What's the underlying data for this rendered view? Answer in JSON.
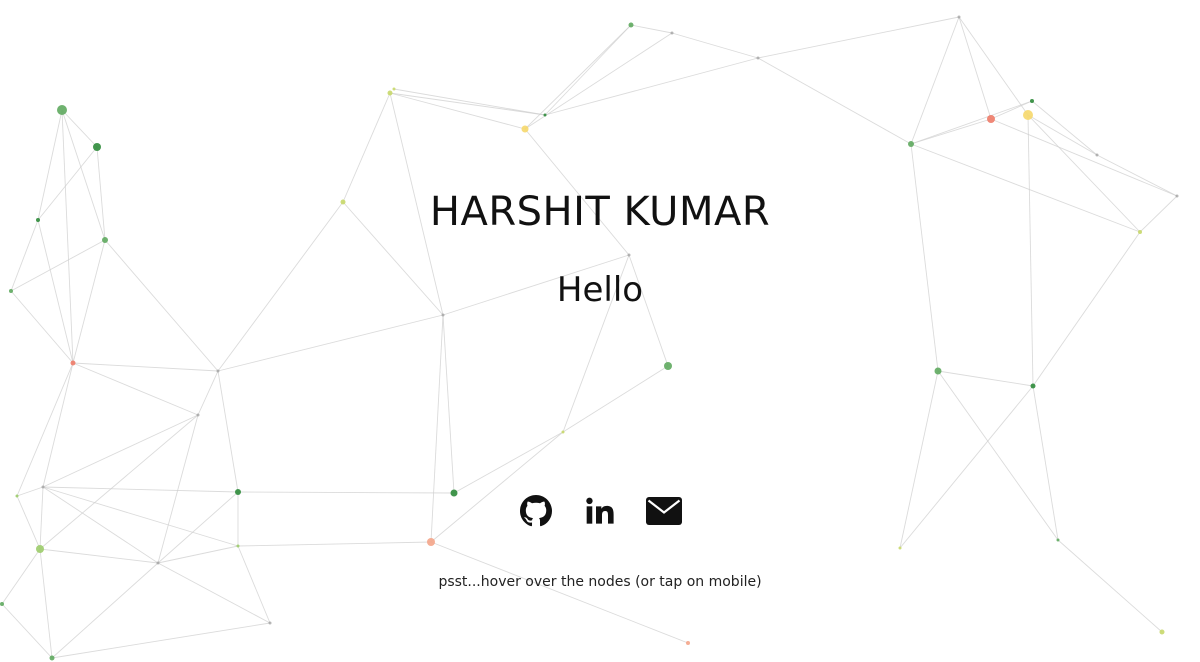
{
  "hero": {
    "name": "HARSHIT KUMAR",
    "greeting": "Hello"
  },
  "socials": [
    {
      "name": "github",
      "icon": "github-icon"
    },
    {
      "name": "linkedin",
      "icon": "linkedin-icon"
    },
    {
      "name": "email",
      "icon": "mail-icon"
    }
  ],
  "hint": "psst...hover over the nodes (or tap on mobile)",
  "colors": {
    "background": "#ffffff",
    "text": "#111111",
    "edge": "#cfcfcf",
    "node_dark_green": "#2e8b3a",
    "node_green": "#5faa5f",
    "node_light_green": "#9ccc6a",
    "node_yellow_green": "#c8d86a",
    "node_yellow": "#f6d86b",
    "node_red": "#ee7b68",
    "node_peach": "#f4a58a"
  }
}
